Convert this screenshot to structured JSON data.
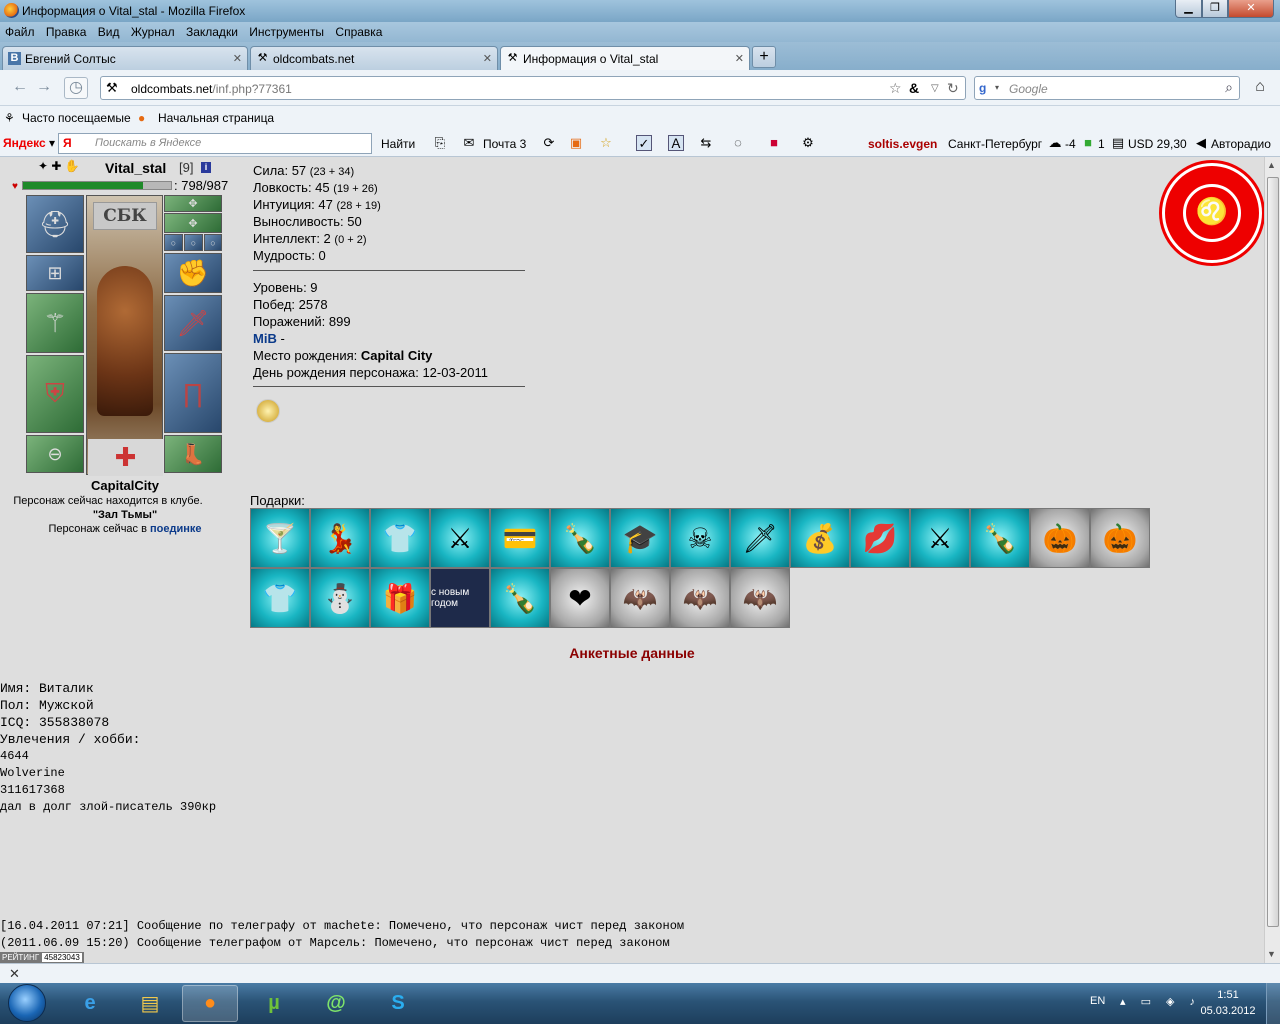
{
  "window": {
    "title": "Информация о Vital_stal - Mozilla Firefox"
  },
  "menu": [
    "Файл",
    "Правка",
    "Вид",
    "Журнал",
    "Закладки",
    "Инструменты",
    "Справка"
  ],
  "tabs": [
    {
      "label": "Евгений Солтыс",
      "icon": "В"
    },
    {
      "label": "oldcombats.net",
      "icon": "⚒"
    },
    {
      "label": "Информация о Vital_stal",
      "icon": "⚒"
    }
  ],
  "nav": {
    "url_host": "oldcombats.net",
    "url_path": "/inf.php?77361",
    "search_placeholder": "Google"
  },
  "bookmarks": [
    "Часто посещаемые",
    "Начальная страница"
  ],
  "yandex": {
    "logo": "Яндекс",
    "search_placeholder": "Поискать в Яндексе",
    "find": "Найти",
    "mail": "Почта 3",
    "user": "soltis.evgen",
    "city": "Санкт-Петербург",
    "temp": "-4",
    "count": "1",
    "usd": "USD 29,30",
    "auto": "Авторадио"
  },
  "character": {
    "name": "Vital_stal",
    "level": "[9]",
    "hp_text": ": 798/987",
    "hp_fraction": 0.81,
    "clan": "СБК",
    "city": "CapitalCity",
    "loc_line1": "Персонаж сейчас находится в клубе.",
    "loc_line2": "\"Зал Тьмы\"",
    "loc_line3_prefix": "Персонаж сейчас в",
    "loc_line3_link": "поединке"
  },
  "stats": {
    "strength": "Сила: 57",
    "strength_mod": "(23 + 34)",
    "agility": "Ловкость: 45",
    "agility_mod": "(19 + 26)",
    "intuition": "Интуиция: 47",
    "intuition_mod": "(28 + 19)",
    "stamina": "Выносливость: 50",
    "intellect": "Интеллект: 2",
    "intellect_mod": "(0 + 2)",
    "wisdom": "Мудрость: 0",
    "level": "Уровень: 9",
    "wins": "Побед: 2578",
    "losses": "Поражений: 899",
    "guild": "MiB",
    "guild_suffix": " -",
    "birthplace_label": "Место рождения: ",
    "birthplace": "Capital City",
    "birthday": "День рождения персонажа: 12-03-2011"
  },
  "gifts_label": "Подарки:",
  "gifts_row1": [
    {
      "icon": "🍸",
      "style": ""
    },
    {
      "icon": "💃",
      "style": ""
    },
    {
      "icon": "👕",
      "style": ""
    },
    {
      "icon": "⚔",
      "style": ""
    },
    {
      "icon": "💳",
      "style": ""
    },
    {
      "icon": "🍾",
      "style": ""
    },
    {
      "icon": "🎓",
      "style": ""
    },
    {
      "icon": "☠",
      "style": ""
    },
    {
      "icon": "🗡",
      "style": ""
    },
    {
      "icon": "💰",
      "style": ""
    },
    {
      "icon": "💋",
      "style": ""
    },
    {
      "icon": "⚔",
      "style": ""
    },
    {
      "icon": "🍾",
      "style": ""
    },
    {
      "icon": "🎃",
      "style": "gray"
    },
    {
      "icon": "🎃",
      "style": "gray"
    }
  ],
  "gifts_row2": [
    {
      "icon": "👕",
      "style": ""
    },
    {
      "icon": "⛄",
      "style": ""
    },
    {
      "icon": "🎁",
      "style": ""
    },
    {
      "icon": "с новым годом",
      "style": "dark"
    },
    {
      "icon": "🍾",
      "style": ""
    },
    {
      "icon": "❤",
      "style": "gray"
    },
    {
      "icon": "🦇",
      "style": "gray"
    },
    {
      "icon": "🦇",
      "style": "gray"
    },
    {
      "icon": "🦇",
      "style": "gray"
    }
  ],
  "anketa": {
    "title": "Анкетные данные",
    "name": "Имя: Виталик",
    "sex": "Пол: Мужской",
    "icq": "ICQ: 355838078",
    "hobby": "Увлечения / хобби:",
    "hobby_lines": [
      "4644",
      "Wolverine",
      "311617368",
      "дал в долг злой-писатель 390кр"
    ]
  },
  "telegraph": [
    "[16.04.2011 07:21] Сообщение по телеграфу от machete: Помечено, что персонаж чист перед законом",
    "(2011.06.09 15:20) Сообщение телеграфом от Марсель: Помечено, что персонаж чист перед законом"
  ],
  "rating": {
    "label": "РЕЙТИНГ",
    "value": "45823043"
  },
  "tray": {
    "lang": "EN",
    "time": "1:51",
    "date": "05.03.2012"
  }
}
